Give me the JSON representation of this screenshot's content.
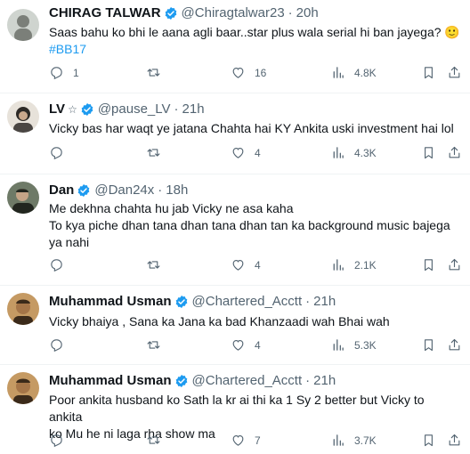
{
  "tweets": [
    {
      "name": "CHIRAG TALWAR",
      "star": "",
      "handle": "@Chiragtalwar23",
      "time": "20h",
      "lines": [
        "Saas bahu ko bhi le aana agli baar..star plus wala serial hi ban jayega? 🙂"
      ],
      "hashtag": "#BB17",
      "replies": "1",
      "retweets": "",
      "likes": "16",
      "views": "4.8K",
      "avatar_colors": [
        "#cfd4cf",
        "#7b7f79"
      ]
    },
    {
      "name": "LV",
      "star": "☆",
      "handle": "@pause_LV",
      "time": "21h",
      "lines": [
        "Vicky bas har waqt ye jatana Chahta hai KY Ankita uski investment hai lol"
      ],
      "hashtag": "",
      "replies": "",
      "retweets": "",
      "likes": "4",
      "views": "4.3K",
      "avatar_colors": [
        "#e7e2da",
        "#2d2a27"
      ]
    },
    {
      "name": "Dan",
      "star": "",
      "handle": "@Dan24x",
      "time": "18h",
      "lines": [
        "Me dekhna chahta hu jab Vicky ne asa kaha",
        "To kya piche dhan tana dhan tana dhan tan ka background music bajega",
        "ya nahi"
      ],
      "hashtag": "",
      "replies": "",
      "retweets": "",
      "likes": "4",
      "views": "2.1K",
      "avatar_colors": [
        "#6e7a67",
        "#22261f"
      ]
    },
    {
      "name": "Muhammad Usman",
      "star": "",
      "handle": "@Chartered_Acctt",
      "time": "21h",
      "lines": [
        "Vicky bhaiya , Sana ka Jana ka bad Khanzaadi wah Bhai wah"
      ],
      "hashtag": "",
      "replies": "",
      "retweets": "",
      "likes": "4",
      "views": "5.3K",
      "avatar_colors": [
        "#c59a63",
        "#3b2a1a"
      ]
    },
    {
      "name": "Muhammad Usman",
      "star": "",
      "handle": "@Chartered_Acctt",
      "time": "21h",
      "lines": [
        "Poor ankita husband ko Sath la kr ai thi ka 1 Sy 2 better but Vicky to ankita",
        "ko Mu he ni laga rha show ma"
      ],
      "hashtag": "",
      "replies": "",
      "retweets": "",
      "likes": "7",
      "views": "3.7K",
      "avatar_colors": [
        "#c59a63",
        "#3b2a1a"
      ]
    }
  ],
  "separator": "·",
  "colors": {
    "accent": "#1d9bf0",
    "muted": "#536471",
    "text": "#0f1419",
    "divider": "#eff3f4"
  }
}
